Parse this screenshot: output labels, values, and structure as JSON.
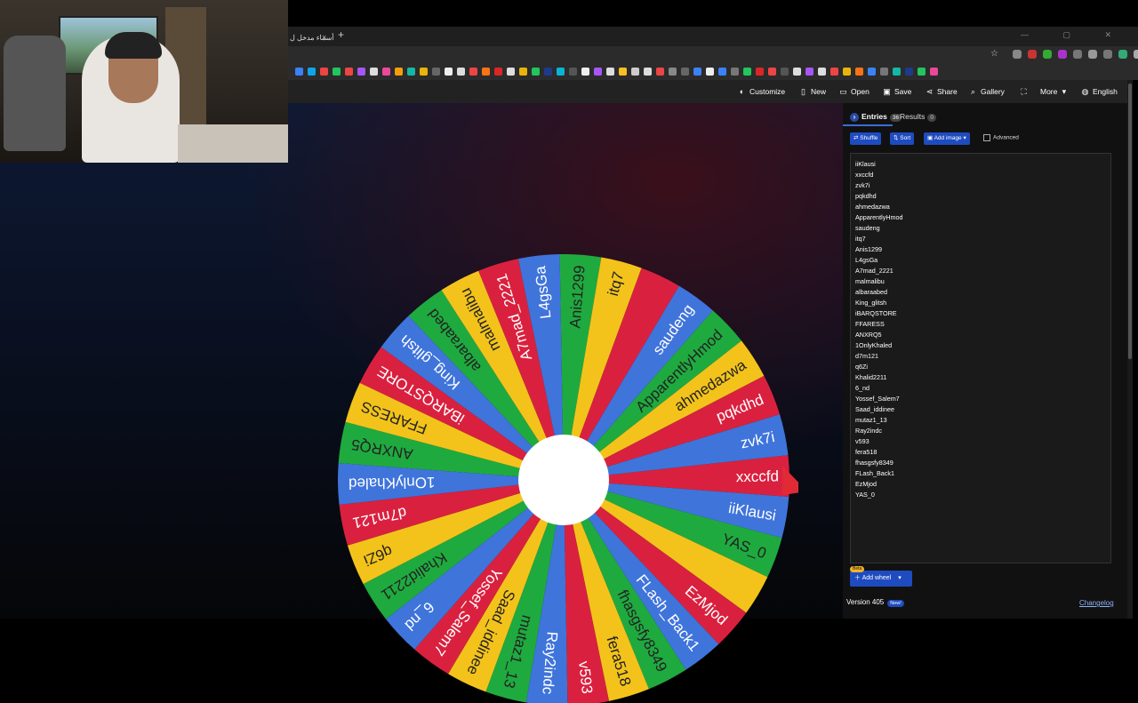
{
  "browser": {
    "tab_title": "أسماء مدخل ل",
    "tab_close": "×",
    "new_tab": "+",
    "win_controls": "— ▢ ✕"
  },
  "toolbar": {
    "customize": "Customize",
    "new": "New",
    "open": "Open",
    "save": "Save",
    "share": "Share",
    "gallery": "Gallery",
    "more": "More",
    "language": "English"
  },
  "side": {
    "entries_tab": "Entries",
    "entries_count": "36",
    "results_tab": "Results",
    "results_count": "0",
    "shuffle": "Shuffle",
    "sort": "Sort",
    "add_image": "Add image",
    "advanced": "Advanced",
    "add_wheel": "Add wheel",
    "beta": "Beta",
    "version": "Version 405",
    "new_badge": "New!",
    "changelog": "Changelog"
  },
  "entries": [
    "iiKlausi",
    "xxccfd",
    "zvk7i",
    "pqkdhd",
    "ahmedazwa",
    "ApparentlyHmod",
    "saudeng",
    "itq7",
    "Anis1299",
    "L4gsGa",
    "A7mad_2221",
    "malmalibu",
    "albaraabed",
    "King_glitsh",
    "iBARQSTORE",
    "FFARESS",
    "ANXRQ5",
    "1OnlyKhaled",
    "d7m121",
    "q6Zi",
    "Khalid2211",
    "6_nd",
    "Yossef_Salem7",
    "Saad_iddinee",
    "mutaz1_13",
    "Ray2indc",
    "v593",
    "fera518",
    "fhasgsfy8349",
    "FLash_Back1",
    "EzMjod",
    "YAS_0"
  ],
  "wheel": {
    "colors": [
      "#d9213f",
      "#3f74db",
      "#1faa3f",
      "#f3c31b"
    ],
    "text_colors": [
      "#ffffff",
      "#ffffff",
      "#222222",
      "#222222"
    ],
    "segments": [
      "xxccfd",
      "iiKlausi",
      "YAS_0",
      "",
      "EzMjod",
      "FLash_Back1",
      "fhasgsfy8349",
      "fera518",
      "v593",
      "Ray2indc",
      "mutaz1_13",
      "Saad_iddinee",
      "Yossef_Salem7",
      "6_nd",
      "Khalid2211",
      "q6Zi",
      "d7m121",
      "1OnlyKhaled",
      "ANXRQ5",
      "FFARESS",
      "iBARQSTORE",
      "King_glitsh",
      "albaraabed",
      "malmalibu",
      "A7mad_2221",
      "L4gsGa",
      "Anis1299",
      "itq7",
      "",
      "saudeng",
      "ApparentlyHmod",
      "ahmedazwa",
      "pqkdhd",
      "zvk7i"
    ]
  }
}
